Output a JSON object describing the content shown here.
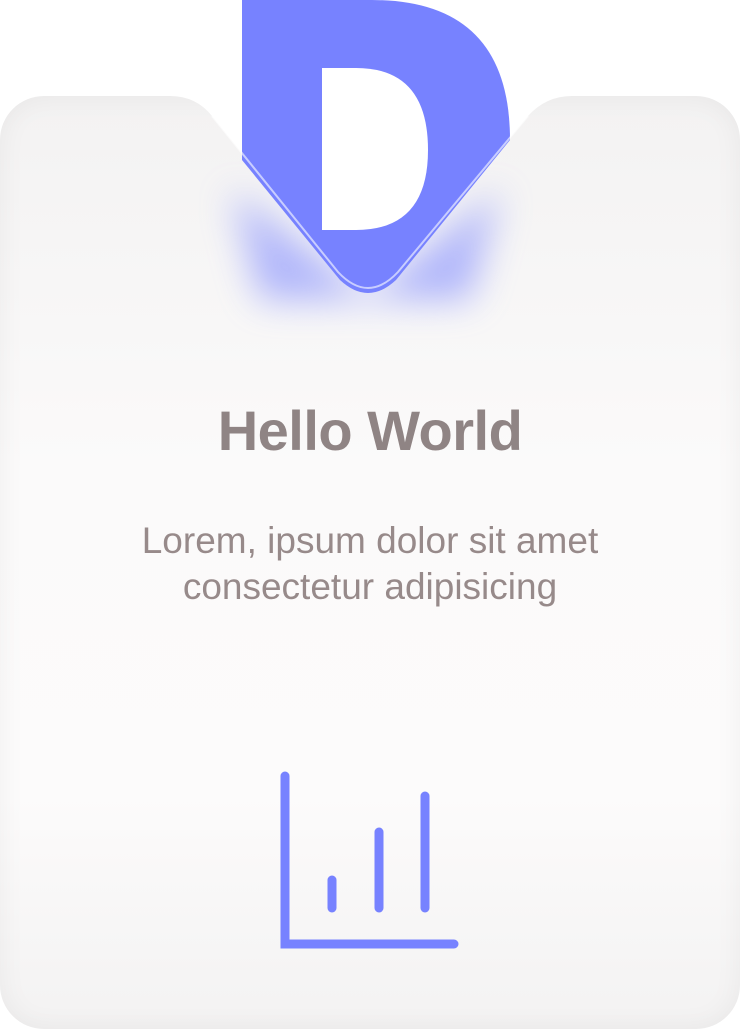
{
  "logo": {
    "letter": "D",
    "color": "#7782ff"
  },
  "card": {
    "title": "Hello World",
    "description": "Lorem, ipsum dolor sit amet consectetur adipisicing"
  },
  "icons": {
    "footer_icon": "bar-chart-icon"
  },
  "colors": {
    "accent": "#7782ff",
    "text": "#8f8484",
    "card_background": "#fbfafa"
  }
}
